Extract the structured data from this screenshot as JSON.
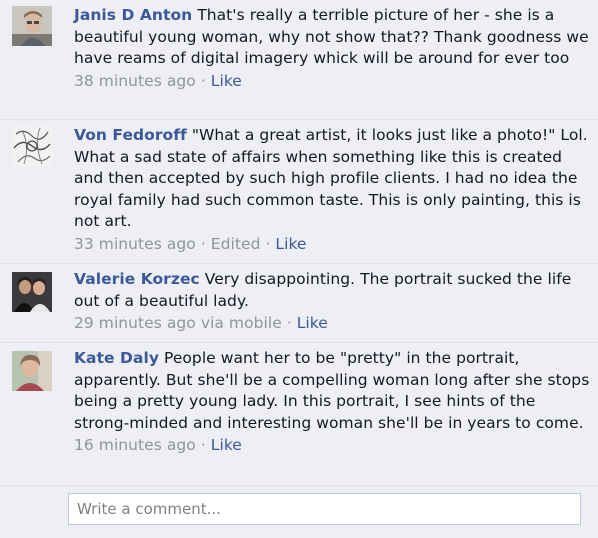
{
  "comments": [
    {
      "author": "Janis D Anton",
      "text": "That's really a terrible picture of her - she is a beautiful young woman, why not show that?? Thank goodness we have reams of digital imagery whick will be around for ever too",
      "time": "38 minutes ago",
      "via": "",
      "edited": "",
      "like": "Like",
      "avatar_icon": "avatar-boy-photo"
    },
    {
      "author": "Von Fedoroff",
      "text": "\"What a great artist, it looks just like a photo!\" Lol. What a sad state of affairs when something like this is created and then accepted by such high profile clients. I had no idea the royal family had such common taste. This is only painting, this is not art.",
      "time": "33 minutes ago",
      "via": "",
      "edited": "Edited",
      "like": "Like",
      "avatar_icon": "avatar-sketch-drawing"
    },
    {
      "author": "Valerie Korzec",
      "text": "Very disappointing. The portrait sucked the life out of a beautiful lady.",
      "time": "29 minutes ago",
      "via": "via mobile",
      "edited": "",
      "like": "Like",
      "avatar_icon": "avatar-couple-photo"
    },
    {
      "author": "Kate Daly",
      "text": "People want her to be \"pretty\" in the portrait, apparently. But she'll be a compelling woman long after she stops being a pretty young lady. In this portrait, I see hints of the strong-minded and interesting woman she'll be in years to come.",
      "time": "16 minutes ago",
      "via": "",
      "edited": "",
      "like": "Like",
      "avatar_icon": "avatar-woman-photo"
    }
  ],
  "separator": " · ",
  "composer": {
    "placeholder": "Write a comment..."
  },
  "colors": {
    "link": "#3b5998",
    "meta": "#90949c",
    "background": "#edeff4"
  }
}
